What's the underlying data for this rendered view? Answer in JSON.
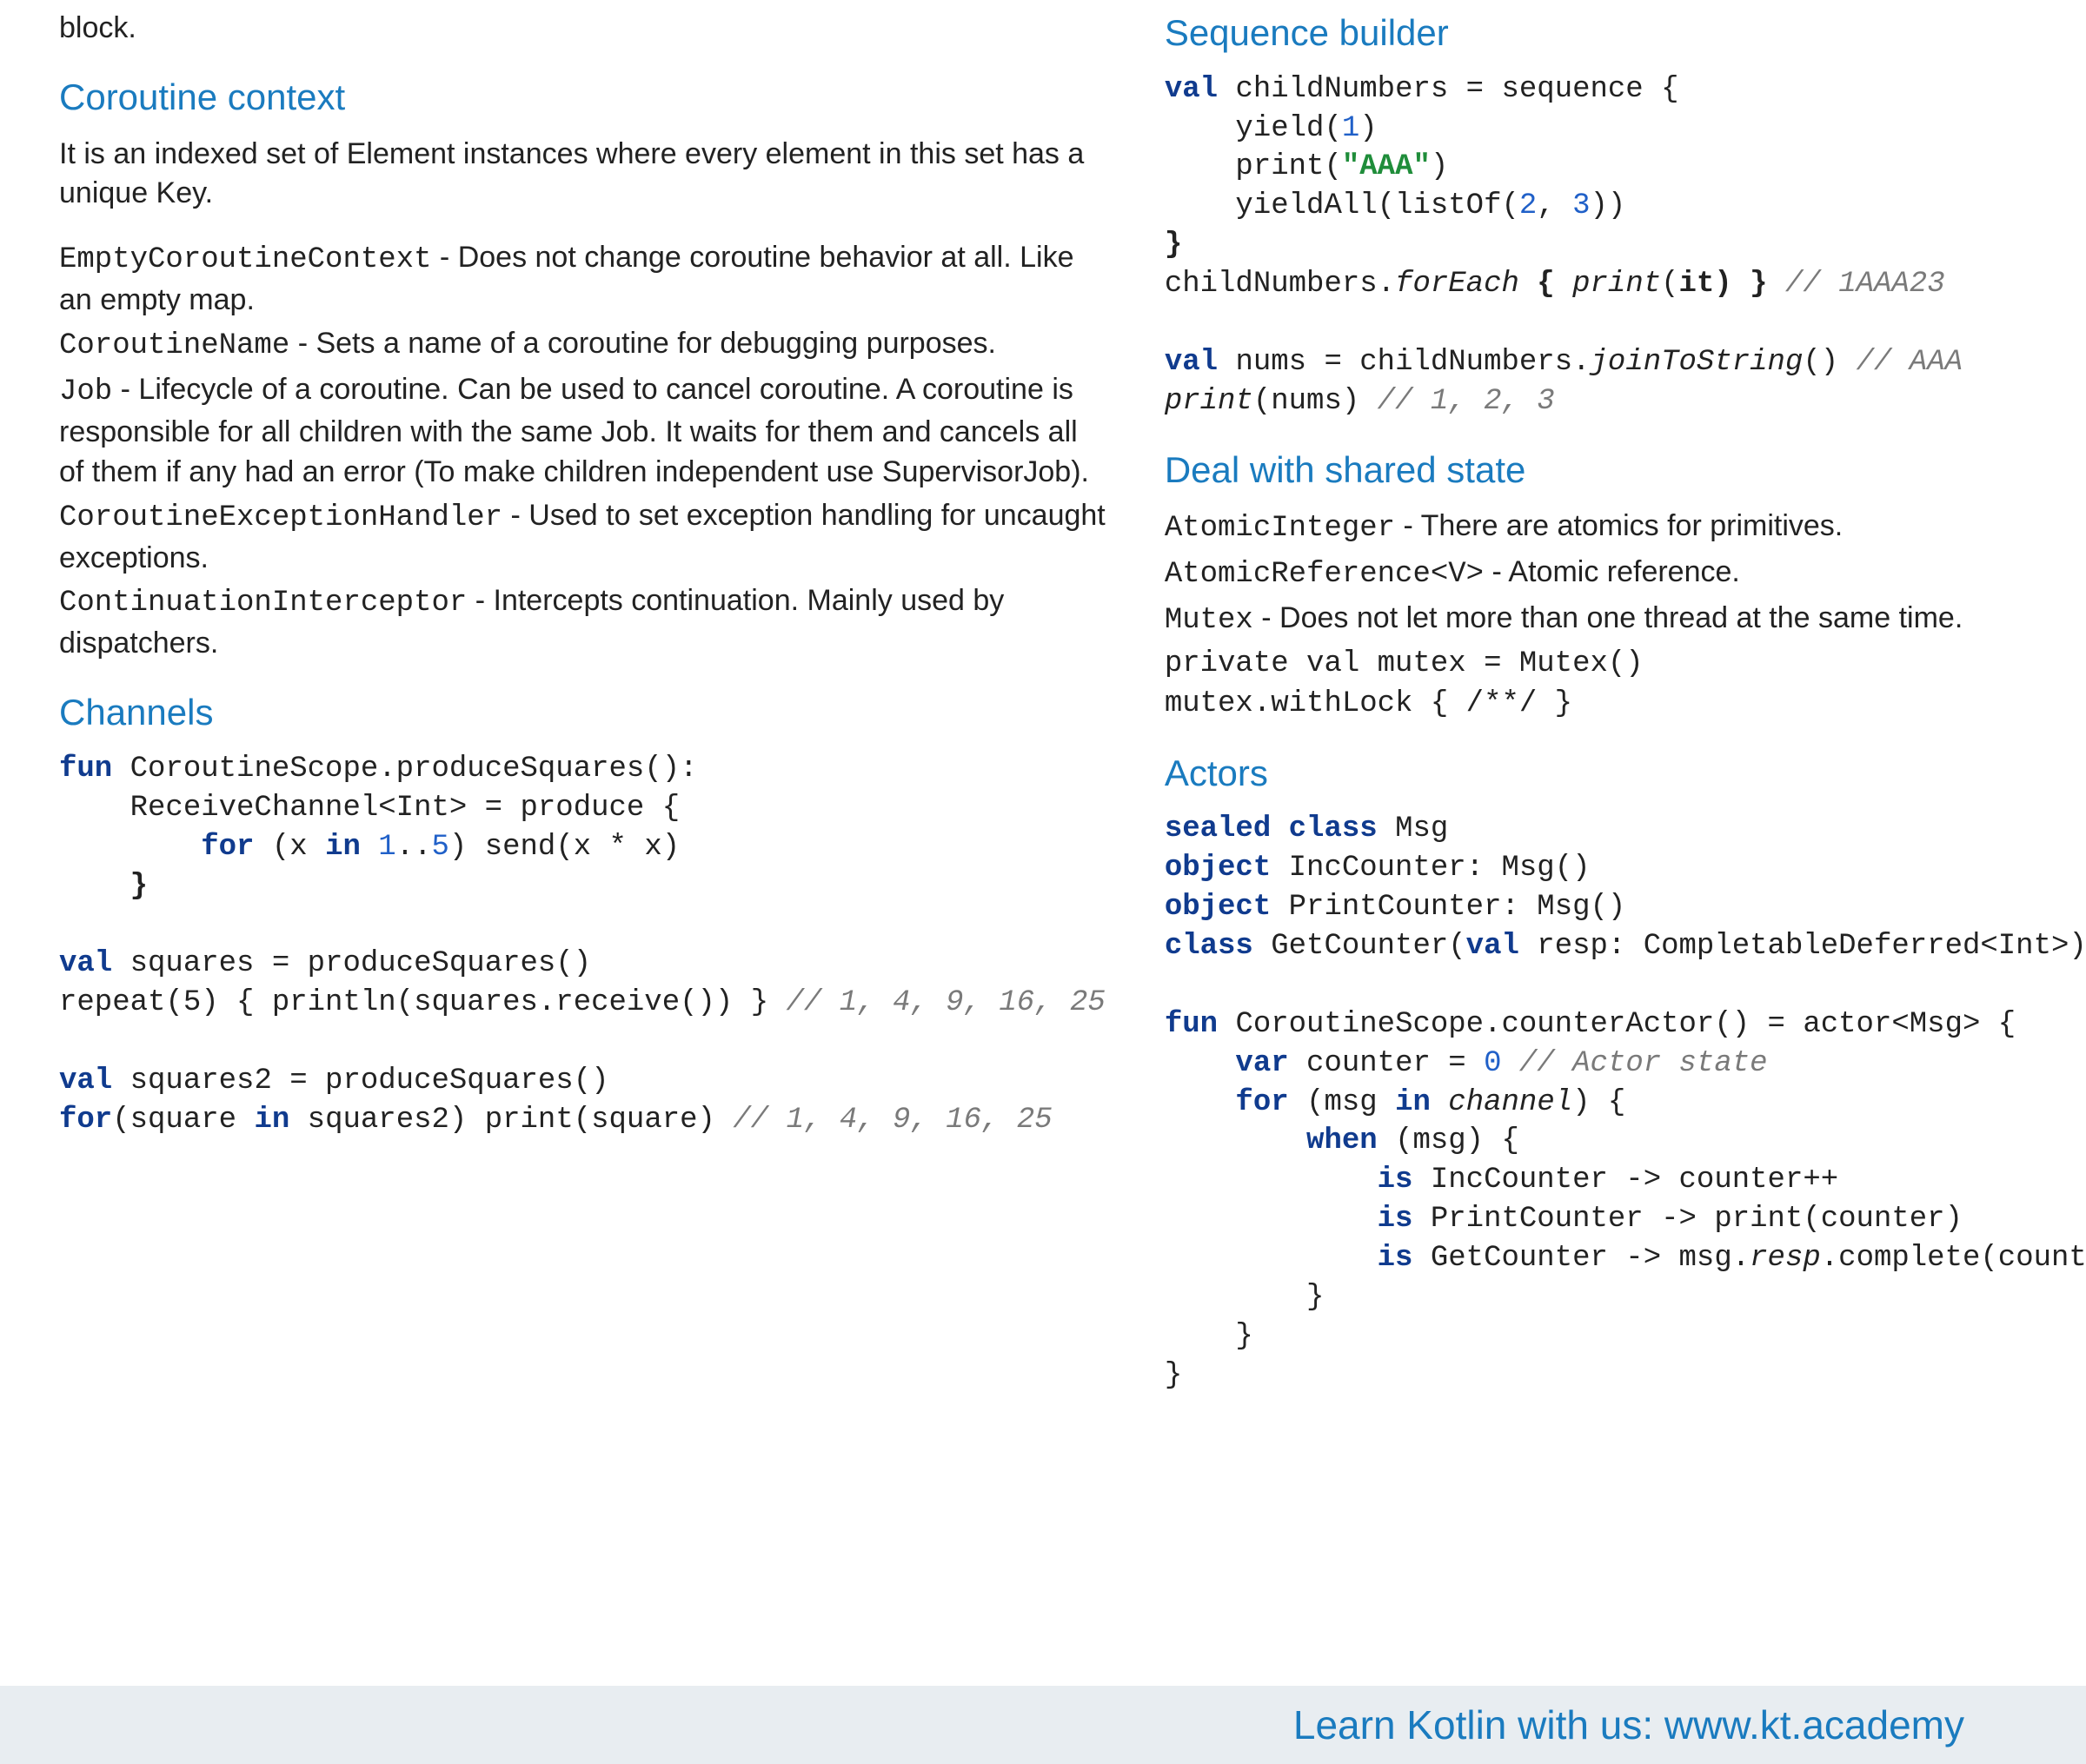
{
  "left": {
    "block_trailer": "block.",
    "h_context": "Coroutine context",
    "context_intro": "It is an indexed set of Element instances where every element in this set has a unique Key.",
    "ctx_items": [
      {
        "name": "EmptyCoroutineContext",
        "desc": " - Does not change coroutine behavior at all. Like an empty map."
      },
      {
        "name": "CoroutineName",
        "desc": " - Sets a name of a coroutine for debugging purposes."
      },
      {
        "name": "Job",
        "desc": " - Lifecycle of a coroutine. Can be used to cancel coroutine. A coroutine is responsible for all children with the same Job. It waits for them and cancels all of them if any had an error (To make children independent use SupervisorJob)."
      },
      {
        "name": "CoroutineExceptionHandler",
        "desc": " - Used to set exception handling for uncaught exceptions."
      },
      {
        "name": "ContinuationInterceptor",
        "desc": " - Intercepts continuation. Mainly used by dispatchers."
      }
    ],
    "h_channels": "Channels",
    "ch": {
      "l1_fun": "fun ",
      "l1_rest": "CoroutineScope.produceSquares():",
      "l2": "    ReceiveChannel<Int> = produce {",
      "l3_for": "        for ",
      "l3_a": "(x ",
      "l3_in": "in ",
      "l3_r1": "1",
      "l3_dot": "..",
      "l3_r2": "5",
      "l3_b": ") send(x * x)",
      "l4": "    }",
      "gap": "",
      "l5_val": "val ",
      "l5": "squares = produceSquares()",
      "l6a": "repeat(5) { println(squares.receive()) } ",
      "l6c": "// 1, 4, 9, 16, 25",
      "l7_val": "val ",
      "l7": "squares2 = produceSquares()",
      "l8_for": "for",
      "l8a": "(square ",
      "l8_in": "in ",
      "l8b": "squares2) print(square) ",
      "l8c": "// 1, 4, 9, 16, 25"
    }
  },
  "right": {
    "h_seq": "Sequence builder",
    "seq": {
      "l1_val": "val ",
      "l1": "childNumbers = sequence {",
      "l2a": "    yield(",
      "l2n": "1",
      "l2b": ")",
      "l3a": "    print(",
      "l3s": "\"AAA\"",
      "l3b": ")",
      "l4a": "    yieldAll(listOf(",
      "l4n1": "2",
      "l4c": ", ",
      "l4n2": "3",
      "l4b": "))",
      "l5": "}",
      "l6a": "childNumbers.",
      "l6it": "forEach",
      "l6b": " { ",
      "l6pr": "print",
      "l6c": "(",
      "l6it2": "it",
      "l6d": ") } ",
      "l6cmt": "// 1AAA23",
      "l7_val": "val ",
      "l7a": "nums = childNumbers.",
      "l7it": "joinToString",
      "l7b": "() ",
      "l7cmt": "// AAA",
      "l8pr": "print",
      "l8a": "(nums) ",
      "l8cmt": "// 1, 2, 3"
    },
    "h_shared": "Deal with shared state",
    "shared_items": [
      {
        "name": "AtomicInteger",
        "desc": " - There are atomics for primitives."
      },
      {
        "name": "AtomicReference<V>",
        "desc": " - Atomic reference."
      },
      {
        "name": "Mutex",
        "desc": " - Does not let more than one thread at the same time."
      }
    ],
    "mutex1": "private val mutex = Mutex()",
    "mutex2": "mutex.withLock { /**/ }",
    "h_actors": "Actors",
    "act": {
      "l1_kw": "sealed class ",
      "l1": "Msg",
      "l2_kw": "object ",
      "l2": "IncCounter: Msg()",
      "l3_kw": "object ",
      "l3": "PrintCounter: Msg()",
      "l4_kw": "class ",
      "l4a": "GetCounter(",
      "l4_val": "val ",
      "l4b": "resp: CompletableDeferred<Int>):Msg()",
      "gap": "",
      "l5_fun": "fun ",
      "l5": "CoroutineScope.counterActor() = actor<Msg> {",
      "l6_var": "    var ",
      "l6a": "counter = ",
      "l6n": "0",
      "l6cmt": " // Actor state",
      "l7_for": "    for ",
      "l7a": "(msg ",
      "l7_in": "in ",
      "l7it": "channel",
      "l7b": ") {",
      "l8_when": "        when ",
      "l8": "(msg) {",
      "l9_is": "            is ",
      "l9": "IncCounter -> counter++",
      "l10_is": "            is ",
      "l10": "PrintCounter -> print(counter)",
      "l11_is": "            is ",
      "l11a": "GetCounter -> msg.",
      "l11it": "resp",
      "l11b": ".complete(counter)",
      "l12": "        }",
      "l13": "    }",
      "l14": "}"
    }
  },
  "footer": "Learn Kotlin with us: www.kt.academy"
}
